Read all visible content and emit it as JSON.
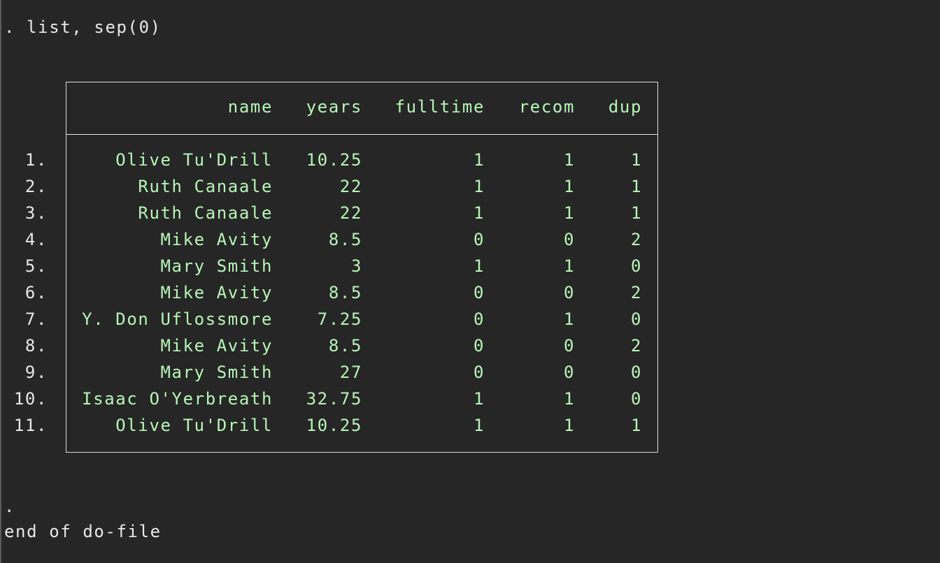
{
  "console": {
    "command": ". list, sep(0)",
    "prompt_dot": ".",
    "footer": "end of do-file"
  },
  "table": {
    "columns": [
      "name",
      "years",
      "fulltime",
      "recom",
      "dup"
    ],
    "rows": [
      {
        "num": "1.",
        "name": "Olive Tu'Drill",
        "years": "10.25",
        "fulltime": "1",
        "recom": "1",
        "dup": "1"
      },
      {
        "num": "2.",
        "name": "Ruth Canaale",
        "years": "22",
        "fulltime": "1",
        "recom": "1",
        "dup": "1"
      },
      {
        "num": "3.",
        "name": "Ruth Canaale",
        "years": "22",
        "fulltime": "1",
        "recom": "1",
        "dup": "1"
      },
      {
        "num": "4.",
        "name": "Mike Avity",
        "years": "8.5",
        "fulltime": "0",
        "recom": "0",
        "dup": "2"
      },
      {
        "num": "5.",
        "name": "Mary Smith",
        "years": "3",
        "fulltime": "1",
        "recom": "1",
        "dup": "0"
      },
      {
        "num": "6.",
        "name": "Mike Avity",
        "years": "8.5",
        "fulltime": "0",
        "recom": "0",
        "dup": "2"
      },
      {
        "num": "7.",
        "name": "Y. Don Uflossmore",
        "years": "7.25",
        "fulltime": "0",
        "recom": "1",
        "dup": "0"
      },
      {
        "num": "8.",
        "name": "Mike Avity",
        "years": "8.5",
        "fulltime": "0",
        "recom": "0",
        "dup": "2"
      },
      {
        "num": "9.",
        "name": "Mary Smith",
        "years": "27",
        "fulltime": "0",
        "recom": "0",
        "dup": "0"
      },
      {
        "num": "10.",
        "name": "Isaac O'Yerbreath",
        "years": "32.75",
        "fulltime": "1",
        "recom": "1",
        "dup": "0"
      },
      {
        "num": "11.",
        "name": "Olive Tu'Drill",
        "years": "10.25",
        "fulltime": "1",
        "recom": "1",
        "dup": "1"
      }
    ]
  },
  "colors": {
    "background": "#262626",
    "output_text": "#b8f5b8",
    "plain_text": "#e8e8e8",
    "table_border": "#dcdcdc"
  }
}
